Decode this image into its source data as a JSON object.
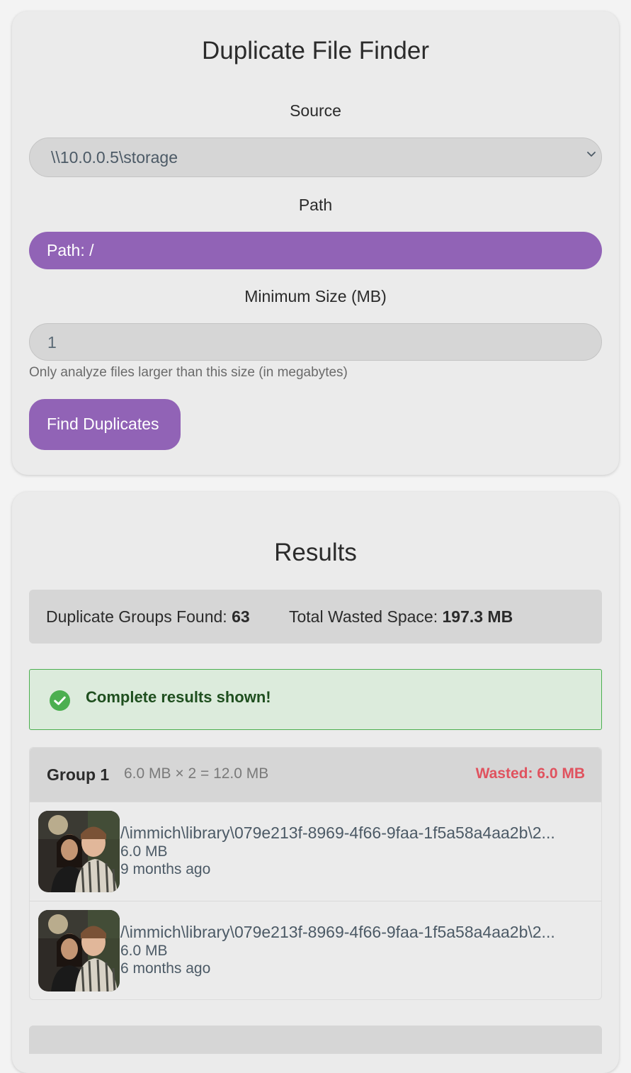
{
  "finder": {
    "title": "Duplicate File Finder",
    "source_label": "Source",
    "source_value": "\\\\10.0.0.5\\storage",
    "path_label": "Path",
    "path_value": "Path: /",
    "min_size_label": "Minimum Size (MB)",
    "min_size_value": "1",
    "min_size_help": "Only analyze files larger than this size (in megabytes)",
    "find_button": "Find Duplicates"
  },
  "results": {
    "title": "Results",
    "groups_found_label": "Duplicate Groups Found:",
    "groups_found_value": "63",
    "wasted_label": "Total Wasted Space:",
    "wasted_value": "197.3 MB",
    "alert_text": "Complete results shown!",
    "alert_icon": "check-circle-icon",
    "groups": [
      {
        "name": "Group 1",
        "calc": "6.0 MB × 2 = 12.0 MB",
        "wasted": "Wasted: 6.0 MB",
        "files": [
          {
            "path": "/\\immich\\library\\079e213f-8969-4f66-9faa-1f5a58a4aa2b\\2...",
            "size": "6.0 MB",
            "age": "9 months ago"
          },
          {
            "path": "/\\immich\\library\\079e213f-8969-4f66-9faa-1f5a58a4aa2b\\2...",
            "size": "6.0 MB",
            "age": "6 months ago"
          }
        ]
      }
    ]
  },
  "colors": {
    "accent": "#9163b6",
    "wasted": "#e0535f",
    "success_bg": "#dcebdc",
    "success_border": "#4caf50"
  }
}
